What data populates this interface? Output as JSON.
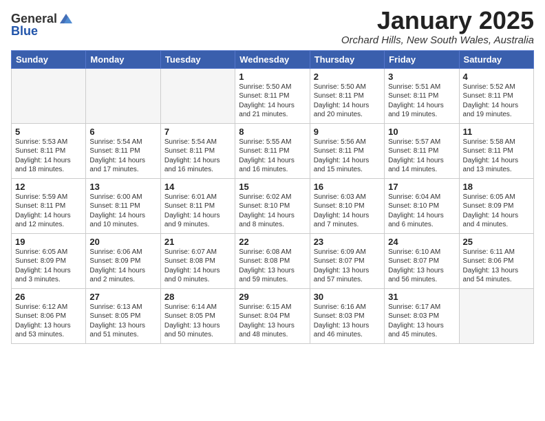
{
  "header": {
    "logo_general": "General",
    "logo_blue": "Blue",
    "month": "January 2025",
    "location": "Orchard Hills, New South Wales, Australia"
  },
  "weekdays": [
    "Sunday",
    "Monday",
    "Tuesday",
    "Wednesday",
    "Thursday",
    "Friday",
    "Saturday"
  ],
  "weeks": [
    [
      {
        "day": "",
        "info": ""
      },
      {
        "day": "",
        "info": ""
      },
      {
        "day": "",
        "info": ""
      },
      {
        "day": "1",
        "info": "Sunrise: 5:50 AM\nSunset: 8:11 PM\nDaylight: 14 hours and 21 minutes."
      },
      {
        "day": "2",
        "info": "Sunrise: 5:50 AM\nSunset: 8:11 PM\nDaylight: 14 hours and 20 minutes."
      },
      {
        "day": "3",
        "info": "Sunrise: 5:51 AM\nSunset: 8:11 PM\nDaylight: 14 hours and 19 minutes."
      },
      {
        "day": "4",
        "info": "Sunrise: 5:52 AM\nSunset: 8:11 PM\nDaylight: 14 hours and 19 minutes."
      }
    ],
    [
      {
        "day": "5",
        "info": "Sunrise: 5:53 AM\nSunset: 8:11 PM\nDaylight: 14 hours and 18 minutes."
      },
      {
        "day": "6",
        "info": "Sunrise: 5:54 AM\nSunset: 8:11 PM\nDaylight: 14 hours and 17 minutes."
      },
      {
        "day": "7",
        "info": "Sunrise: 5:54 AM\nSunset: 8:11 PM\nDaylight: 14 hours and 16 minutes."
      },
      {
        "day": "8",
        "info": "Sunrise: 5:55 AM\nSunset: 8:11 PM\nDaylight: 14 hours and 16 minutes."
      },
      {
        "day": "9",
        "info": "Sunrise: 5:56 AM\nSunset: 8:11 PM\nDaylight: 14 hours and 15 minutes."
      },
      {
        "day": "10",
        "info": "Sunrise: 5:57 AM\nSunset: 8:11 PM\nDaylight: 14 hours and 14 minutes."
      },
      {
        "day": "11",
        "info": "Sunrise: 5:58 AM\nSunset: 8:11 PM\nDaylight: 14 hours and 13 minutes."
      }
    ],
    [
      {
        "day": "12",
        "info": "Sunrise: 5:59 AM\nSunset: 8:11 PM\nDaylight: 14 hours and 12 minutes."
      },
      {
        "day": "13",
        "info": "Sunrise: 6:00 AM\nSunset: 8:11 PM\nDaylight: 14 hours and 10 minutes."
      },
      {
        "day": "14",
        "info": "Sunrise: 6:01 AM\nSunset: 8:11 PM\nDaylight: 14 hours and 9 minutes."
      },
      {
        "day": "15",
        "info": "Sunrise: 6:02 AM\nSunset: 8:10 PM\nDaylight: 14 hours and 8 minutes."
      },
      {
        "day": "16",
        "info": "Sunrise: 6:03 AM\nSunset: 8:10 PM\nDaylight: 14 hours and 7 minutes."
      },
      {
        "day": "17",
        "info": "Sunrise: 6:04 AM\nSunset: 8:10 PM\nDaylight: 14 hours and 6 minutes."
      },
      {
        "day": "18",
        "info": "Sunrise: 6:05 AM\nSunset: 8:09 PM\nDaylight: 14 hours and 4 minutes."
      }
    ],
    [
      {
        "day": "19",
        "info": "Sunrise: 6:05 AM\nSunset: 8:09 PM\nDaylight: 14 hours and 3 minutes."
      },
      {
        "day": "20",
        "info": "Sunrise: 6:06 AM\nSunset: 8:09 PM\nDaylight: 14 hours and 2 minutes."
      },
      {
        "day": "21",
        "info": "Sunrise: 6:07 AM\nSunset: 8:08 PM\nDaylight: 14 hours and 0 minutes."
      },
      {
        "day": "22",
        "info": "Sunrise: 6:08 AM\nSunset: 8:08 PM\nDaylight: 13 hours and 59 minutes."
      },
      {
        "day": "23",
        "info": "Sunrise: 6:09 AM\nSunset: 8:07 PM\nDaylight: 13 hours and 57 minutes."
      },
      {
        "day": "24",
        "info": "Sunrise: 6:10 AM\nSunset: 8:07 PM\nDaylight: 13 hours and 56 minutes."
      },
      {
        "day": "25",
        "info": "Sunrise: 6:11 AM\nSunset: 8:06 PM\nDaylight: 13 hours and 54 minutes."
      }
    ],
    [
      {
        "day": "26",
        "info": "Sunrise: 6:12 AM\nSunset: 8:06 PM\nDaylight: 13 hours and 53 minutes."
      },
      {
        "day": "27",
        "info": "Sunrise: 6:13 AM\nSunset: 8:05 PM\nDaylight: 13 hours and 51 minutes."
      },
      {
        "day": "28",
        "info": "Sunrise: 6:14 AM\nSunset: 8:05 PM\nDaylight: 13 hours and 50 minutes."
      },
      {
        "day": "29",
        "info": "Sunrise: 6:15 AM\nSunset: 8:04 PM\nDaylight: 13 hours and 48 minutes."
      },
      {
        "day": "30",
        "info": "Sunrise: 6:16 AM\nSunset: 8:03 PM\nDaylight: 13 hours and 46 minutes."
      },
      {
        "day": "31",
        "info": "Sunrise: 6:17 AM\nSunset: 8:03 PM\nDaylight: 13 hours and 45 minutes."
      },
      {
        "day": "",
        "info": ""
      }
    ]
  ]
}
